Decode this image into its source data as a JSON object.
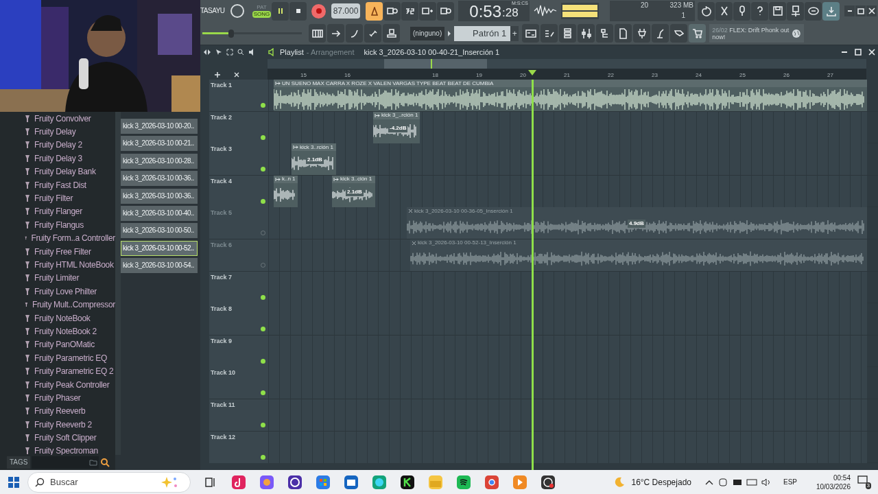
{
  "toolbar": {
    "user_label": "TASAYU",
    "master_volume": {
      "level": 0.29
    },
    "mode": [
      {
        "label": "PAT",
        "selected": false
      },
      {
        "label": "SONG",
        "selected": true
      }
    ],
    "tempo": "87.000",
    "time": "0:53",
    "time_cs": ":28",
    "time_unit": "M:S:CS",
    "cpu_voices": "20",
    "memory": "323 MB",
    "polyphony": "1",
    "pattern_picker": "(ninguno)",
    "pattern": "Patrón 1",
    "add_pattern": "+",
    "news_date": "26/02",
    "news_text": "FLEX: Drift Phonk out now!"
  },
  "browser": {
    "plugins": [
      "Fruity Convolver",
      "Fruity Delay",
      "Fruity Delay 2",
      "Fruity Delay 3",
      "Fruity Delay Bank",
      "Fruity Fast Dist",
      "Fruity Filter",
      "Fruity Flanger",
      "Fruity Flangus",
      "Fruity Form..a Controller",
      "Fruity Free Filter",
      "Fruity HTML NoteBook",
      "Fruity Limiter",
      "Fruity Love Philter",
      "Fruity Mult..Compressor",
      "Fruity NoteBook",
      "Fruity NoteBook 2",
      "Fruity PanOMatic",
      "Fruity Parametric EQ",
      "Fruity Parametric EQ 2",
      "Fruity Peak Controller",
      "Fruity Phaser",
      "Fruity Reeverb",
      "Fruity Reeverb 2",
      "Fruity Soft Clipper",
      "Fruity Spectroman"
    ],
    "tags_label": "TAGS"
  },
  "clip_pool": [
    {
      "label": "kick 3_2026-03-10 00-20..",
      "selected": false
    },
    {
      "label": "kick 3_2026-03-10 00-21..",
      "selected": false
    },
    {
      "label": "kick 3_2026-03-10 00-28..",
      "selected": false
    },
    {
      "label": "kick 3_2026-03-10 00-36..",
      "selected": false
    },
    {
      "label": "kick 3_2026-03-10 00-36..",
      "selected": false
    },
    {
      "label": "kick 3_2026-03-10 00-40..",
      "selected": false
    },
    {
      "label": "kick 3_2026-03-10 00-50..",
      "selected": false
    },
    {
      "label": "kick 3_2026-03-10 00-52..",
      "selected": true
    },
    {
      "label": "kick 3_2026-03-10 00-54..",
      "selected": false
    }
  ],
  "playlist": {
    "title": "Playlist",
    "subtitle": "- Arrangement",
    "current_clip": "kick 3_2026-03-10 00-40-21_Inserción 1",
    "ruler": [
      "15",
      "16",
      "18",
      "19",
      "20",
      "21",
      "22",
      "23",
      "24",
      "25",
      "26",
      "27"
    ],
    "tracks": [
      {
        "name": "Track 1",
        "enabled": true,
        "clips": [
          {
            "label": "UN SUENO MAX CARRA X ROZE X VALEN VARGAS TYPE BEAT  BEAT DE CUMBIA",
            "muted": false
          }
        ]
      },
      {
        "name": "Track 2",
        "enabled": true,
        "clips": [
          {
            "label": "kick 3_..rción 1",
            "gain": "-4.2dB",
            "muted": false
          }
        ]
      },
      {
        "name": "Track 3",
        "enabled": true,
        "clips": [
          {
            "label": "kick 3..rción 1",
            "gain": "2.1dB",
            "muted": false
          }
        ]
      },
      {
        "name": "Track 4",
        "enabled": true,
        "clips": [
          {
            "label": "k..n 1",
            "muted": false
          },
          {
            "label": "kick 3..ción 1",
            "gain": "2.1dB",
            "muted": false
          }
        ]
      },
      {
        "name": "Track 5",
        "enabled": false,
        "clips": [
          {
            "label": "kick 3_2026-03-10 00-36-05_Inserción 1",
            "gain": "4.9dB",
            "muted": true
          }
        ]
      },
      {
        "name": "Track 6",
        "enabled": false,
        "clips": [
          {
            "label": "kick 3_2026-03-10 00-52-13_Inserción 1",
            "muted": true
          }
        ]
      },
      {
        "name": "Track 7",
        "enabled": true
      },
      {
        "name": "Track 8",
        "enabled": true
      },
      {
        "name": "Track 9",
        "enabled": true
      },
      {
        "name": "Track 10",
        "enabled": true
      },
      {
        "name": "Track 11",
        "enabled": true
      },
      {
        "name": "Track 12",
        "enabled": true
      }
    ]
  },
  "taskbar": {
    "search_placeholder": "Buscar",
    "weather": "16°C Despejado",
    "language": "ESP",
    "time": "00:54",
    "date": "10/03/2026",
    "notifications": "3"
  }
}
